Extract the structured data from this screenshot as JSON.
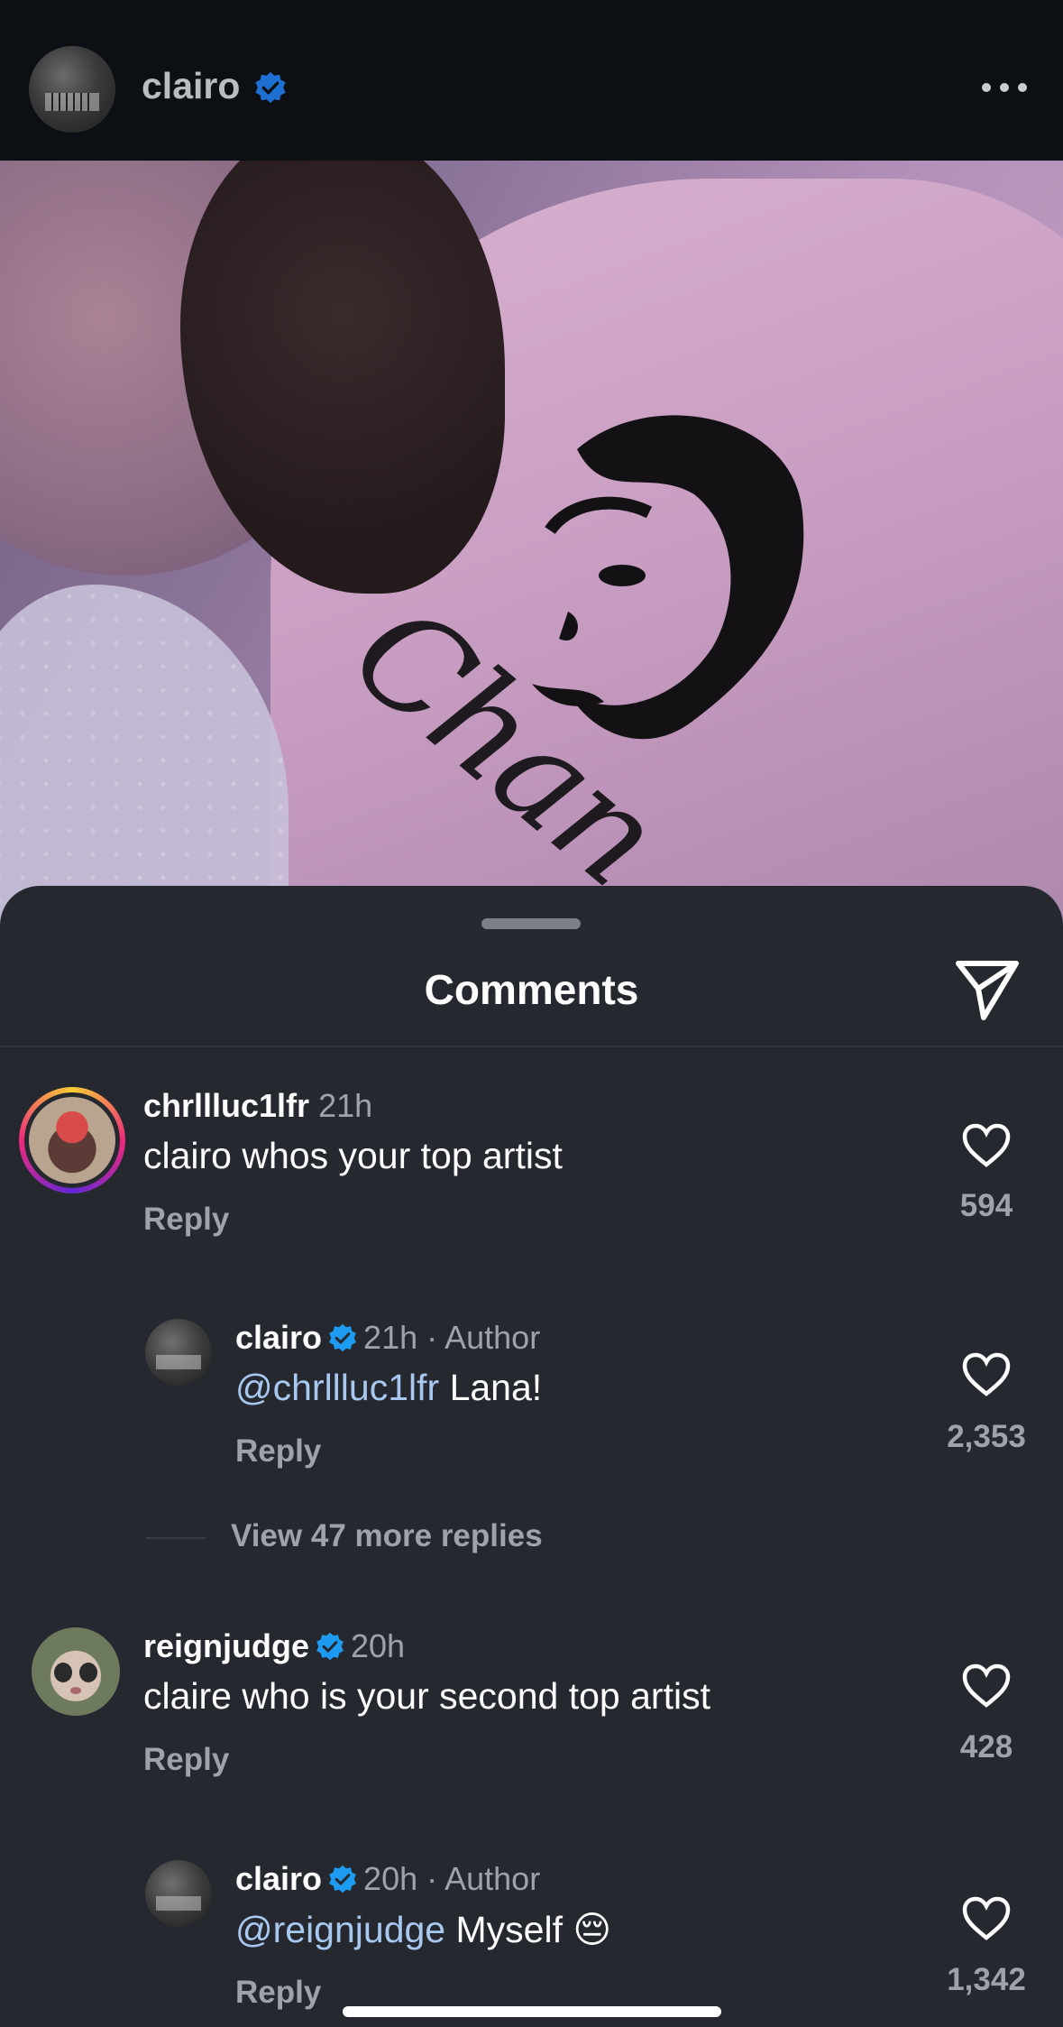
{
  "header": {
    "username": "clairo",
    "verified": true,
    "more_icon": "more-horizontal-icon"
  },
  "post": {
    "photo_print_text": "Chan"
  },
  "comments_sheet": {
    "title": "Comments",
    "share_icon": "send-icon",
    "comments": [
      {
        "username": "chrllluc1lfr",
        "verified": false,
        "time": "21h",
        "text": "clairo whos your top artist",
        "reply_label": "Reply",
        "likes": "594",
        "has_story": true
      },
      {
        "username": "clairo",
        "verified": true,
        "time": "21h · Author",
        "mention": "@chrllluc1lfr",
        "text": " Lana!",
        "reply_label": "Reply",
        "likes": "2,353",
        "is_reply": true
      },
      {
        "username": "reignjudge",
        "verified": true,
        "time": "20h",
        "text": "claire who is your second top artist",
        "reply_label": "Reply",
        "likes": "428"
      },
      {
        "username": "clairo",
        "verified": true,
        "time": "20h · Author",
        "mention": "@reignjudge",
        "text": " Myself 😔",
        "reply_label": "Reply",
        "likes": "1,342",
        "is_reply": true
      }
    ],
    "view_more_replies": "View 47 more replies"
  },
  "colors": {
    "background": "#25282e",
    "verified_blue": "#1d9bf0",
    "mention": "#a8c8f0",
    "muted": "#9ea2a9"
  }
}
